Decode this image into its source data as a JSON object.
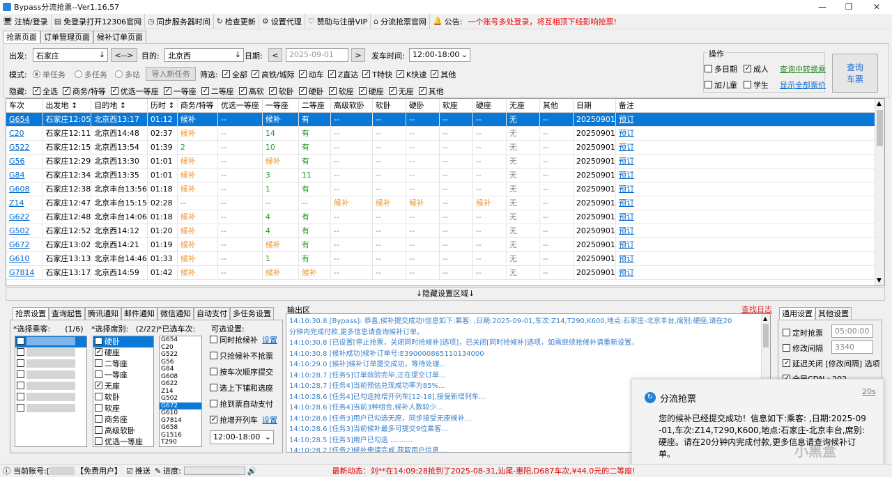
{
  "app": {
    "title": "Bypass分流抢票--Ver1.16.57"
  },
  "menu": [
    {
      "icon": "monitor-icon",
      "glyph": "🖥",
      "label": "注销/登录"
    },
    {
      "icon": "window-icon",
      "glyph": "▤",
      "label": "免登录打开12306官网"
    },
    {
      "icon": "clock-icon",
      "glyph": "◷",
      "label": "同步服务器时间"
    },
    {
      "icon": "refresh-icon",
      "glyph": "↻",
      "label": "检查更新"
    },
    {
      "icon": "gear-icon",
      "glyph": "⚙",
      "label": "设置代理"
    },
    {
      "icon": "heart-icon",
      "glyph": "♡",
      "label": "赞助与注册VIP"
    },
    {
      "icon": "home-icon",
      "glyph": "⌂",
      "label": "分流抢票官网"
    },
    {
      "icon": "announce-icon",
      "glyph": "🔔",
      "label": "公告:"
    }
  ],
  "announcement": "一个账号多处登录，将互相顶下线影响抢票!",
  "main_tabs": [
    "抢票页面",
    "订单管理页面",
    "候补订单页面"
  ],
  "query": {
    "from_label": "出发:",
    "from": "石家庄",
    "swap": "<-->",
    "to_label": "目的:",
    "to": "北京西",
    "date_label": "日期:",
    "date": "2025-09-01",
    "prev": "<",
    "next": ">",
    "time_label": "发车时间:",
    "time": "12:00-18:00",
    "mode_label": "模式:",
    "modes": [
      "单任务",
      "多任务",
      "多站"
    ],
    "import_btn": "导入新任务",
    "filter_label": "筛选:",
    "filters": [
      {
        "label": "全部",
        "c": true
      },
      {
        "label": "高铁/城际",
        "c": true
      },
      {
        "label": "动车",
        "c": true
      },
      {
        "label": "Z直达",
        "c": true
      },
      {
        "label": "T特快",
        "c": true
      },
      {
        "label": "K快速",
        "c": true
      },
      {
        "label": "其他",
        "c": true
      }
    ],
    "hide_label": "隐藏:",
    "hides": [
      "全选",
      "商务/特等",
      "优选一等座",
      "一等座",
      "二等座",
      "高软",
      "软卧",
      "硬卧",
      "软座",
      "硬座",
      "无座",
      "其他"
    ],
    "ops_label": "操作",
    "ops": [
      {
        "label": "多日期",
        "c": false
      },
      {
        "label": "成人",
        "c": true
      },
      {
        "label": "加儿童",
        "c": false
      },
      {
        "label": "学生",
        "c": false
      }
    ],
    "transfer_link": "查询中转换乘",
    "show_all_link": "显示全部票价",
    "search_btn_1": "查询",
    "search_btn_2": "车票"
  },
  "table": {
    "headers": [
      "车次",
      "出发地 ↕",
      "目的地 ↕",
      "历时 ↕",
      "商务/特等",
      "优选一等座",
      "一等座",
      "二等座",
      "高级软卧",
      "软卧",
      "硬卧",
      "软座",
      "硬座",
      "无座",
      "其他",
      "日期",
      "备注"
    ],
    "rows": [
      [
        "G654",
        "石家庄12:05",
        "北京西13:17",
        "01:12",
        "候补",
        "--",
        "候补",
        "有",
        "--",
        "--",
        "--",
        "--",
        "--",
        "无",
        "--",
        "20250901",
        "预订"
      ],
      [
        "C20",
        "石家庄12:11",
        "北京西14:48",
        "02:37",
        "候补",
        "--",
        "14",
        "有",
        "--",
        "--",
        "--",
        "--",
        "--",
        "无",
        "--",
        "20250901",
        "预订"
      ],
      [
        "G522",
        "石家庄12:15",
        "北京西13:54",
        "01:39",
        "2",
        "--",
        "10",
        "有",
        "--",
        "--",
        "--",
        "--",
        "--",
        "无",
        "--",
        "20250901",
        "预订"
      ],
      [
        "G56",
        "石家庄12:29",
        "北京西13:30",
        "01:01",
        "候补",
        "--",
        "候补",
        "有",
        "--",
        "--",
        "--",
        "--",
        "--",
        "无",
        "--",
        "20250901",
        "预订"
      ],
      [
        "G84",
        "石家庄12:34",
        "北京西13:35",
        "01:01",
        "候补",
        "--",
        "3",
        "11",
        "--",
        "--",
        "--",
        "--",
        "--",
        "无",
        "--",
        "20250901",
        "预订"
      ],
      [
        "G608",
        "石家庄12:38",
        "北京丰台13:56",
        "01:18",
        "候补",
        "--",
        "1",
        "有",
        "--",
        "--",
        "--",
        "--",
        "--",
        "无",
        "--",
        "20250901",
        "预订"
      ],
      [
        "Z14",
        "石家庄12:47",
        "北京丰台15:15",
        "02:28",
        "--",
        "--",
        "--",
        "--",
        "候补",
        "候补",
        "候补",
        "--",
        "候补",
        "无",
        "--",
        "20250901",
        "预订"
      ],
      [
        "G622",
        "石家庄12:48",
        "北京丰台14:06",
        "01:18",
        "候补",
        "--",
        "4",
        "有",
        "--",
        "--",
        "--",
        "--",
        "--",
        "无",
        "--",
        "20250901",
        "预订"
      ],
      [
        "G502",
        "石家庄12:52",
        "北京西14:12",
        "01:20",
        "候补",
        "--",
        "4",
        "有",
        "--",
        "--",
        "--",
        "--",
        "--",
        "无",
        "--",
        "20250901",
        "预订"
      ],
      [
        "G672",
        "石家庄13:02",
        "北京西14:21",
        "01:19",
        "候补",
        "--",
        "候补",
        "有",
        "--",
        "--",
        "--",
        "--",
        "--",
        "无",
        "--",
        "20250901",
        "预订"
      ],
      [
        "G610",
        "石家庄13:13",
        "北京丰台14:46",
        "01:33",
        "候补",
        "--",
        "1",
        "有",
        "--",
        "--",
        "--",
        "--",
        "--",
        "无",
        "--",
        "20250901",
        "预订"
      ],
      [
        "G7814",
        "石家庄13:17",
        "北京西14:59",
        "01:42",
        "候补",
        "--",
        "候补",
        "候补",
        "--",
        "--",
        "--",
        "--",
        "--",
        "无",
        "--",
        "20250901",
        "预订"
      ]
    ],
    "selected_row": 0
  },
  "hide_area": "↓隐藏设置区域↓",
  "bottom_tabs": [
    "抢票设置",
    "查询起售",
    "腾讯通知",
    "邮件通知",
    "微信通知",
    "自动支付",
    "多任务设置"
  ],
  "passengers": {
    "label": "*选择乘客:",
    "count": "(1/6)",
    "checks": [
      true,
      false,
      false,
      false,
      false,
      false,
      false
    ]
  },
  "seats": {
    "label": "*选择席别:",
    "count": "(2/22)",
    "items": [
      {
        "label": "硬卧",
        "c": false,
        "sel": true
      },
      {
        "label": "硬座",
        "c": true
      },
      {
        "label": "二等座",
        "c": false
      },
      {
        "label": "一等座",
        "c": false
      },
      {
        "label": "无座",
        "c": true
      },
      {
        "label": "软卧",
        "c": false
      },
      {
        "label": "软座",
        "c": false
      },
      {
        "label": "商务座",
        "c": false
      },
      {
        "label": "高级软卧",
        "c": false
      },
      {
        "label": "优选一等座",
        "c": false
      }
    ]
  },
  "trains": {
    "label": "*已选车次:",
    "items": [
      "G654",
      "C20",
      "G522",
      "G56",
      "G84",
      "G608",
      "G622",
      "Z14",
      "G502",
      "G672",
      "G610",
      "G7814",
      "G658",
      "G1516",
      "T290"
    ],
    "selected": "G672"
  },
  "options": {
    "label": "可选设置:",
    "items": [
      {
        "label": "同时抢候补",
        "c": false,
        "link": "设置"
      },
      {
        "label": "只抢候补不抢票",
        "c": false
      },
      {
        "label": "按车次顺序提交",
        "c": false
      },
      {
        "label": "选上下铺和选座",
        "c": false
      },
      {
        "label": "抢到票自动支付",
        "c": false
      },
      {
        "label": "抢增开列车",
        "c": true,
        "link": "设置"
      }
    ],
    "time": "12:00-18:00"
  },
  "log": {
    "label": "输出区",
    "search": "查找日志",
    "lines": [
      "14:10:30.8  [Bypass]: 恭喜,候补提交成功!信息如下:乘客:        ,日期:2025-09-01,车次:Z14,T290,K600,地点:石家庄-北京丰台,席别:硬座,请在20",
      "分钟内完成付款,更多信息请查询候补订单。",
      "14:10:30.8  [已设置[停止抢票，关闭同时抢候补]选项]，已关闭[同时抢候补]选项，如需继续抢候补请重新设置。",
      "14:10:30.8  [候补成功]候补订单号:E390000865110134000",
      "14:10:29.0  [候补]候补订单提交成功，等待处理...",
      "14:10:28.7  [任务5]订单效验完毕,正在提交订单...",
      "14:10:28.7  [任务4]当前预估兑现成功率为85%...",
      "14:10:28.6  [任务4]已勾选抢增开列车[12-18],接受新增列车...",
      "14:10:28.6  [任务4]当前3种组合,候补人数较少...",
      "14:10:28.6  [任务3]用户已勾选无座，同步接受无座候补...",
      "14:10:28.6  [任务3]当前候补最多可提交9位乘客...",
      "14:10:28.5  [任务3]用户已勾选 ..........",
      "14:10:28.2  [任务2]候补申请完成,获取用户信息..."
    ]
  },
  "general_tabs": [
    "通用设置",
    "其他设置"
  ],
  "general": {
    "items": [
      {
        "label": "定时抢票",
        "c": false,
        "value": "05:00:00"
      },
      {
        "label": "修改间隔",
        "c": false,
        "value": "3340"
      },
      {
        "label": "延迟关闭 [修改间隔] 选项",
        "c": true
      },
      {
        "label": "全局CDN",
        "c": true,
        "value": "202"
      }
    ]
  },
  "toast": {
    "title": "分流抢票",
    "time": "20s",
    "body": "您的候补已经提交成功！信息如下:乘客:        ,日期:2025-09-01,车次:Z14,T290,K600,地点:石家庄-北京丰台,席别:硬座。请在20分钟内完成付款,更多信息请查询候补订单。"
  },
  "status": {
    "account_label": "当前账号:[",
    "account_suffix": "【免费用户】",
    "push": "推送",
    "progress": "进度:",
    "news": "最新动态：刘**在14:09:28抢到了2025-08-31,汕尾-惠阳,D687车次,¥44.0元的二等座!"
  },
  "watermark": "小黑盒"
}
